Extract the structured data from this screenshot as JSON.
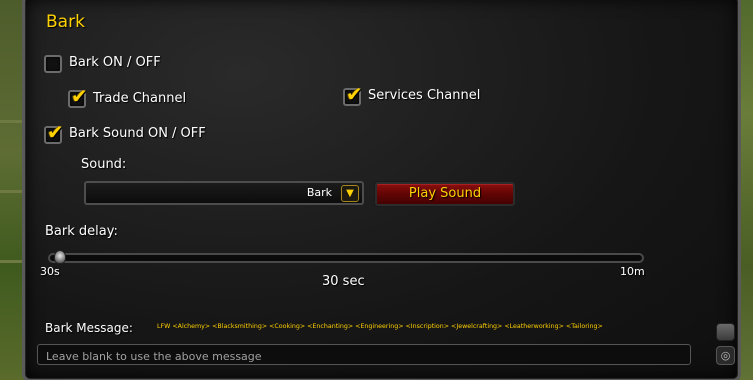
{
  "section": {
    "title": "Bark"
  },
  "options": {
    "bark_toggle": {
      "label": "Bark ON / OFF",
      "checked": false
    },
    "trade_channel": {
      "label": "Trade Channel",
      "checked": true
    },
    "services_channel": {
      "label": "Services Channel",
      "checked": true
    },
    "bark_sound_toggle": {
      "label": "Bark Sound ON / OFF",
      "checked": true
    }
  },
  "sound": {
    "label": "Sound:",
    "selected": "Bark",
    "play_button": "Play Sound"
  },
  "delay": {
    "label": "Bark delay:",
    "min_label": "30s",
    "max_label": "10m",
    "current_label": "30 sec",
    "value_fraction": 0.0
  },
  "message": {
    "label": "Bark Message:",
    "tags": "LFW <Alchemy> <Blacksmithing> <Cooking> <Enchanting> <Engineering> <Inscription> <Jewelcrafting> <Leatherworking> <Tailoring>",
    "placeholder": "Leave blank to use the above message",
    "value": ""
  },
  "icons": {
    "check": "✔",
    "dropdown_arrow": "▼",
    "scroll": "◎"
  },
  "colors": {
    "gold": "#ffd100",
    "button_red": "#6e0808"
  }
}
